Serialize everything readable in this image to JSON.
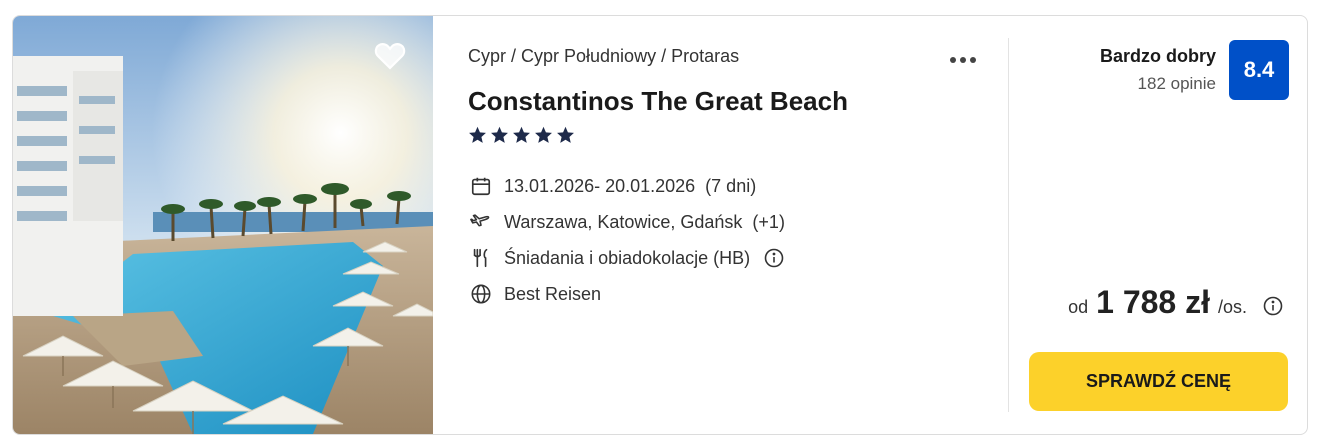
{
  "hotel": {
    "breadcrumb": "Cypr / Cypr Południowy / Protaras",
    "name": "Constantinos The Great Beach",
    "stars": 5,
    "dates": "13.01.2026- 20.01.2026",
    "duration": "(7 dni)",
    "departure": "Warszawa, Katowice, Gdańsk",
    "departure_extra": "(+1)",
    "board": "Śniadania i obiadokolacje (HB)",
    "operator": "Best Reisen"
  },
  "rating": {
    "label": "Bardzo dobry",
    "reviews": "182 opinie",
    "score": "8.4"
  },
  "price": {
    "prefix": "od",
    "amount": "1 788 zł",
    "suffix": "/os."
  },
  "cta": {
    "label": "SPRAWDŹ CENĘ"
  },
  "icons": {
    "favorite": "heart-icon",
    "more": "more-options-icon",
    "dates": "calendar-icon",
    "departure": "plane-icon",
    "board": "fork-knife-icon",
    "board_info": "info-icon",
    "operator": "globe-icon",
    "price_info": "info-icon"
  },
  "colors": {
    "score_bg": "#0050c8",
    "cta_bg": "#fcd12a",
    "stars": "#1e2a4a"
  }
}
